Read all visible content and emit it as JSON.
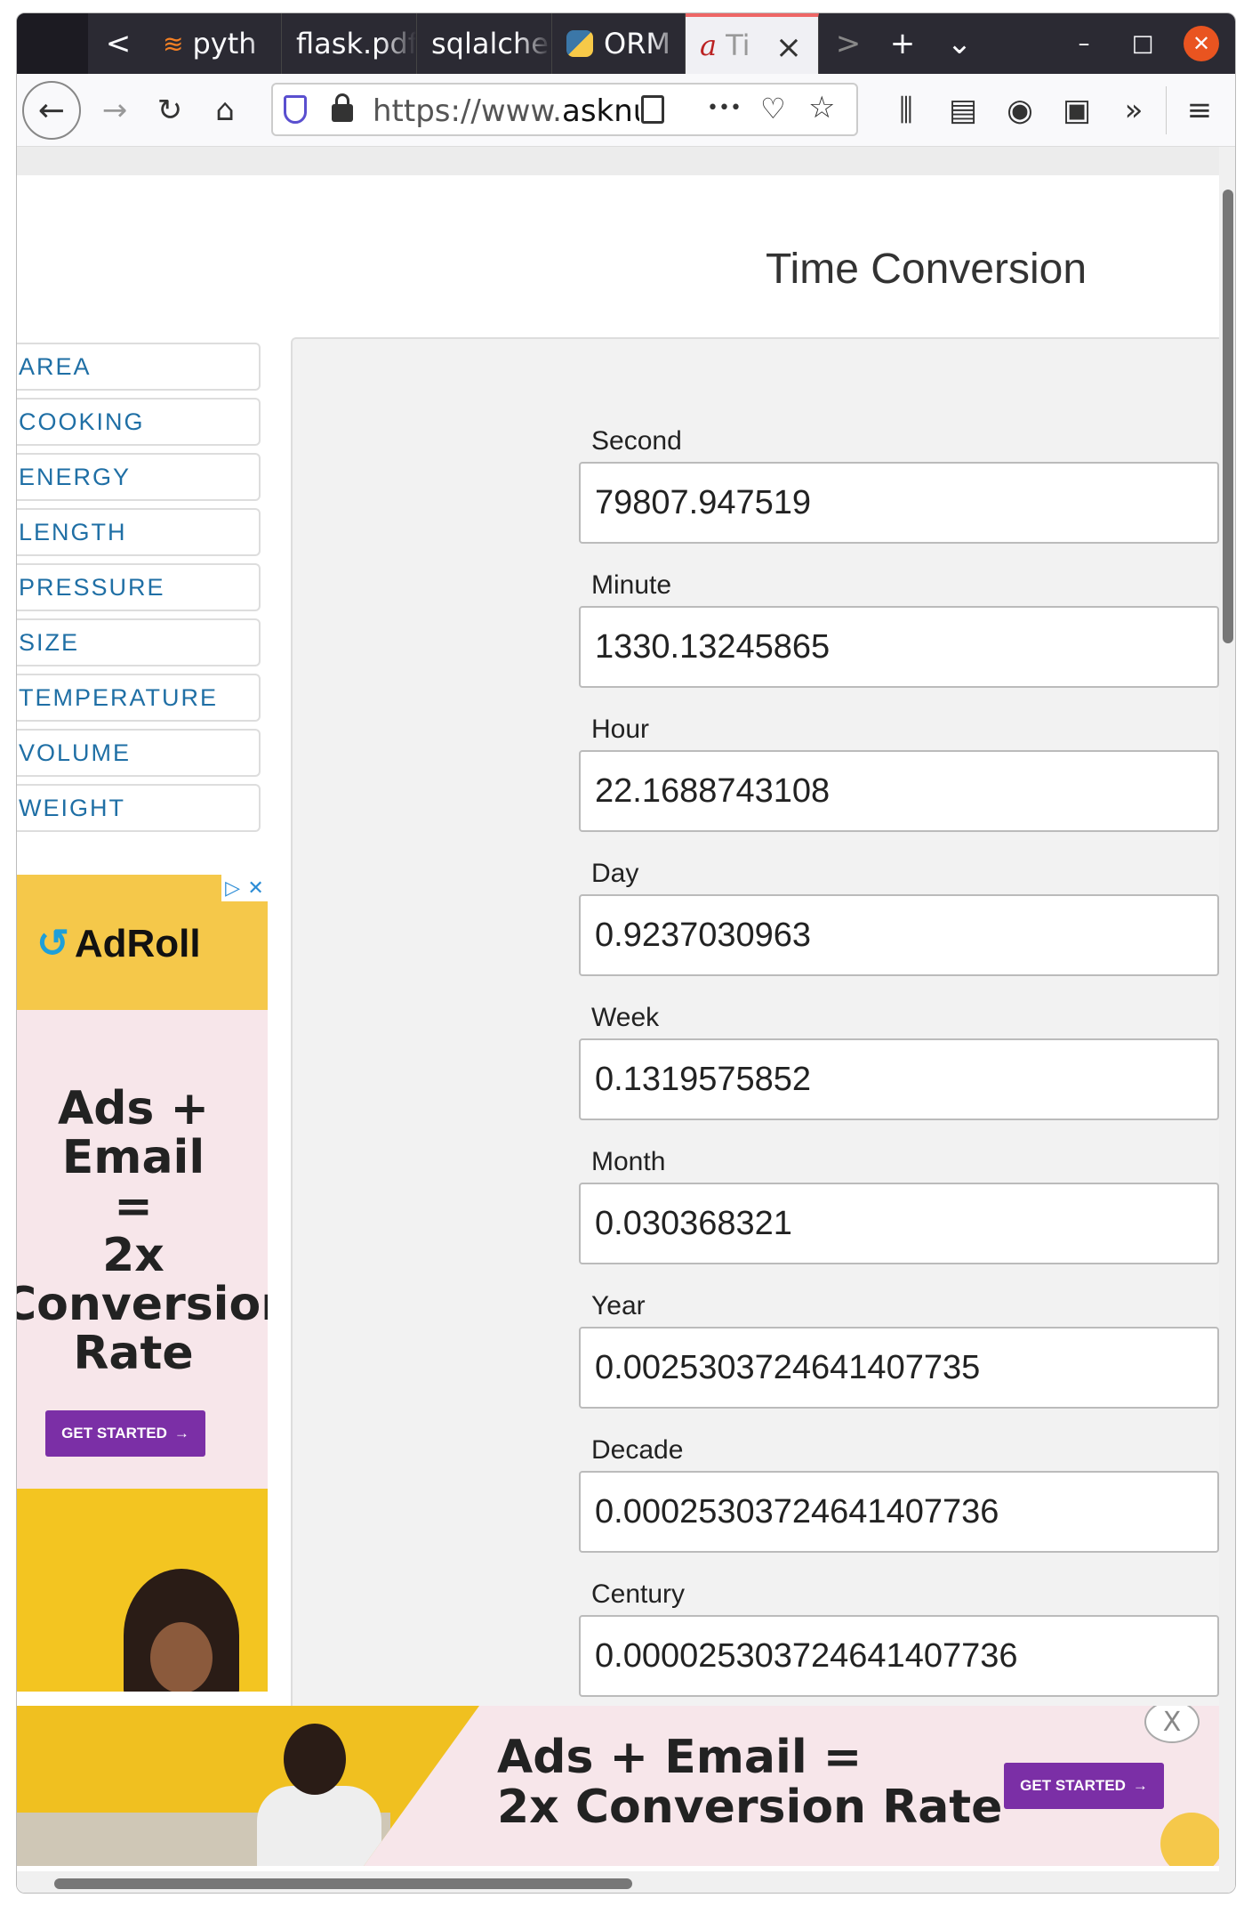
{
  "browser": {
    "tabs": [
      {
        "label": "pyth",
        "icon": "stackoverflow-icon",
        "active": false
      },
      {
        "label": "flask.pdf",
        "icon": "none",
        "active": false
      },
      {
        "label": "sqlalche",
        "icon": "none",
        "active": false
      },
      {
        "label": "ORM",
        "icon": "python-icon",
        "active": false
      },
      {
        "label": "Ti",
        "icon": "asknumbers-icon",
        "active": true
      }
    ],
    "url_prefix": "https://www.",
    "url_host": "asknum",
    "icons": {
      "back": "←",
      "forward": "→",
      "reload": "↻",
      "home": "⌂",
      "tab_prev": "<",
      "tab_next": ">",
      "new_tab": "+",
      "tab_list": "⌄",
      "minimize": "–",
      "maximize": "□",
      "close": "✕",
      "more": "•••",
      "pocket": "♡",
      "star": "☆",
      "library": "⫼",
      "sidebar": "▤",
      "account": "◉",
      "extension": "▣",
      "overflow": "»",
      "menu": "≡",
      "tab_close": "×"
    }
  },
  "page": {
    "title": "Time Conversion",
    "menu": [
      "AREA",
      "COOKING",
      "ENERGY",
      "LENGTH",
      "PRESSURE",
      "SIZE",
      "TEMPERATURE",
      "VOLUME",
      "WEIGHT"
    ],
    "fields": [
      {
        "label": "Second",
        "value": "79807.947519"
      },
      {
        "label": "Minute",
        "value": "1330.13245865"
      },
      {
        "label": "Hour",
        "value": "22.1688743108"
      },
      {
        "label": "Day",
        "value": "0.9237030963"
      },
      {
        "label": "Week",
        "value": "0.1319575852"
      },
      {
        "label": "Month",
        "value": "0.030368321"
      },
      {
        "label": "Year",
        "value": "0.0025303724641407735"
      },
      {
        "label": "Decade",
        "value": "0.00025303724641407736"
      },
      {
        "label": "Century",
        "value": "0.000025303724641407736"
      }
    ]
  },
  "side_ad": {
    "brand": "AdRoll",
    "headline_lines": [
      "Ads +",
      "Email",
      "=",
      "2x",
      "Conversion",
      "Rate"
    ],
    "cta": "GET STARTED"
  },
  "bottom_ad": {
    "headline_lines": [
      "Ads + Email =",
      "2x Conversion Rate"
    ],
    "cta": "GET STARTED",
    "close": "X"
  }
}
